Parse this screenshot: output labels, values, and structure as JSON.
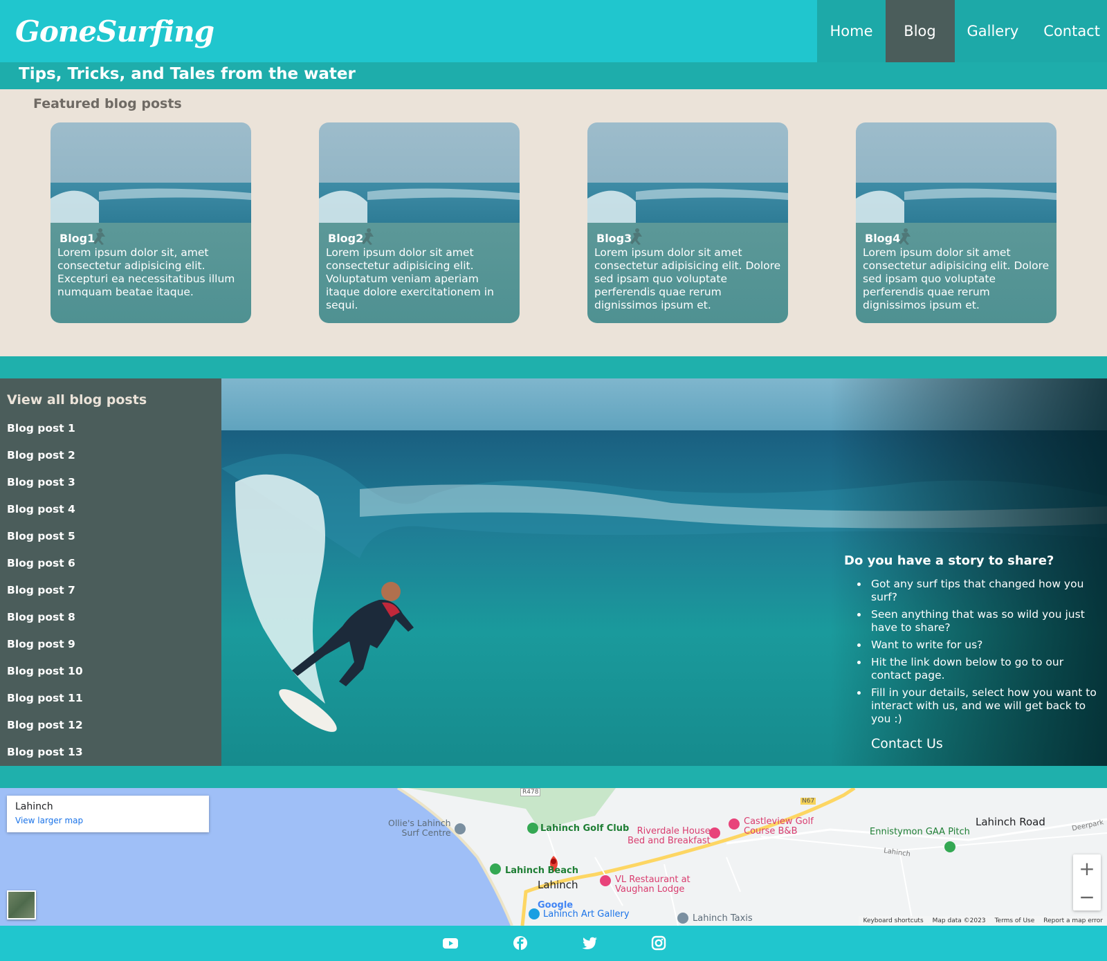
{
  "header": {
    "logo_text": "GoneSurfing",
    "tagline": "Tips, Tricks, and Tales from the water",
    "nav": [
      {
        "label": "Home"
      },
      {
        "label": "Blog",
        "active": true
      },
      {
        "label": "Gallery"
      },
      {
        "label": "Contact"
      }
    ]
  },
  "featured": {
    "title": "Featured blog posts",
    "cards": [
      {
        "title": "Blog1",
        "text": "Lorem ipsum dolor sit, amet consectetur adipisicing elit. Excepturi ea necessitatibus illum numquam beatae itaque."
      },
      {
        "title": "Blog2",
        "text": "Lorem ipsum dolor sit amet consectetur adipisicing elit. Voluptatum veniam aperiam itaque dolore exercitationem in sequi."
      },
      {
        "title": "Blog3",
        "text": "Lorem ipsum dolor sit amet consectetur adipisicing elit. Dolore sed ipsam quo voluptate perferendis quae rerum dignissimos ipsum et."
      },
      {
        "title": "Blog4",
        "text": "Lorem ipsum dolor sit amet consectetur adipisicing elit. Dolore sed ipsam quo voluptate perferendis quae rerum dignissimos ipsum et."
      }
    ]
  },
  "sidebar": {
    "title": "View all blog posts",
    "items": [
      "Blog post 1",
      "Blog post 2",
      "Blog post 3",
      "Blog post 4",
      "Blog post 5",
      "Blog post 6",
      "Blog post 7",
      "Blog post 8",
      "Blog post 9",
      "Blog post 10",
      "Blog post 11",
      "Blog post 12",
      "Blog post 13"
    ]
  },
  "story": {
    "title": "Do you have a story to share?",
    "items": [
      "Got any surf tips that changed how you surf?",
      "Seen anything that was so wild you just have to share?",
      "Want to write for us?",
      "Hit the link down below to go to our contact page.",
      "Fill in your details, select how you want to interact with us, and we will get back to you :)"
    ],
    "contact_label": "Contact Us"
  },
  "map": {
    "place_title": "Lahinch",
    "larger_map_label": "View larger map",
    "labels": {
      "ollies": "Ollie's Lahinch\nSurf Centre",
      "golf_club": "Lahinch Golf Club",
      "riverdale": "Riverdale House\nBed and Breakfast",
      "castleview": "Castleview Golf\nCourse B&B",
      "ennistymon": "Ennistymon GAA Pitch",
      "lahinch_road": "Lahinch Road",
      "lahinch_beach": "Lahinch Beach",
      "lahinch_town": "Lahinch",
      "vl_restaurant": "VL Restaurant at\nVaughan Lodge",
      "art_gallery": "Lahinch Art Gallery",
      "taxis": "Lahinch Taxis",
      "deerpark": "Deerpark",
      "road_lahinch": "Lahinch",
      "r478": "R478",
      "n67": "N67",
      "google": "Google"
    },
    "zoom_in": "+",
    "zoom_out": "−",
    "footer": [
      "Keyboard shortcuts",
      "Map data ©2023",
      "Terms of Use",
      "Report a map error"
    ]
  },
  "social": [
    {
      "icon": "youtube-icon"
    },
    {
      "icon": "facebook-icon"
    },
    {
      "icon": "twitter-icon"
    },
    {
      "icon": "instagram-icon"
    }
  ],
  "colors": {
    "header_teal": "#20c6ce",
    "band_teal": "#1fb0ac",
    "active_nav": "#4b5d5b",
    "cream": "#ebe3d9",
    "sidebar": "#4b5d5b"
  }
}
